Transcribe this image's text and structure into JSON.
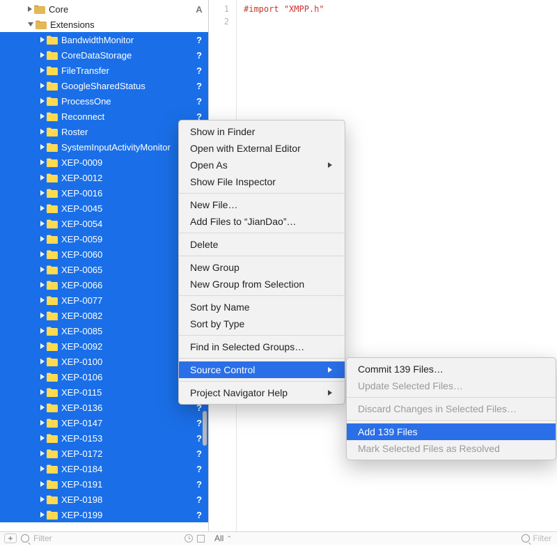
{
  "sidebar": {
    "top": [
      {
        "label": "Core",
        "indent": 40,
        "open": false,
        "status": "A",
        "selected": false
      },
      {
        "label": "Extensions",
        "indent": 40,
        "open": true,
        "status": "",
        "selected": false
      }
    ],
    "selected": [
      "BandwidthMonitor",
      "CoreDataStorage",
      "FileTransfer",
      "GoogleSharedStatus",
      "ProcessOne",
      "Reconnect",
      "Roster",
      "SystemInputActivityMonitor",
      "XEP-0009",
      "XEP-0012",
      "XEP-0016",
      "XEP-0045",
      "XEP-0054",
      "XEP-0059",
      "XEP-0060",
      "XEP-0065",
      "XEP-0066",
      "XEP-0077",
      "XEP-0082",
      "XEP-0085",
      "XEP-0092",
      "XEP-0100",
      "XEP-0106",
      "XEP-0115",
      "XEP-0136",
      "XEP-0147",
      "XEP-0153",
      "XEP-0172",
      "XEP-0184",
      "XEP-0191",
      "XEP-0198",
      "XEP-0199"
    ],
    "selected_indent": 58,
    "selected_status": "?",
    "filter_placeholder": "Filter"
  },
  "editor": {
    "lines": [
      "1",
      "2"
    ],
    "line1": {
      "keyword": "#import",
      "string": "\"XMPP.h\""
    },
    "bottom_left": "All",
    "bottom_right": "Filter"
  },
  "context_menu": {
    "groups": [
      [
        "Show in Finder",
        "Open with External Editor",
        {
          "label": "Open As",
          "submenu": true
        },
        "Show File Inspector"
      ],
      [
        "New File…",
        "Add Files to “JianDao”…"
      ],
      [
        "Delete"
      ],
      [
        "New Group",
        "New Group from Selection"
      ],
      [
        "Sort by Name",
        "Sort by Type"
      ],
      [
        "Find in Selected Groups…"
      ],
      [
        {
          "label": "Source Control",
          "submenu": true,
          "selected": true
        }
      ],
      [
        {
          "label": "Project Navigator Help",
          "submenu": true
        }
      ]
    ]
  },
  "submenu": {
    "items": [
      {
        "label": "Commit 139 Files…",
        "disabled": false
      },
      {
        "label": "Update Selected Files…",
        "disabled": true
      },
      {
        "sep": true
      },
      {
        "label": "Discard Changes in Selected Files…",
        "disabled": true
      },
      {
        "sep": true
      },
      {
        "label": "Add 139 Files",
        "selected": true
      },
      {
        "label": "Mark Selected Files as Resolved",
        "disabled": true
      }
    ]
  }
}
